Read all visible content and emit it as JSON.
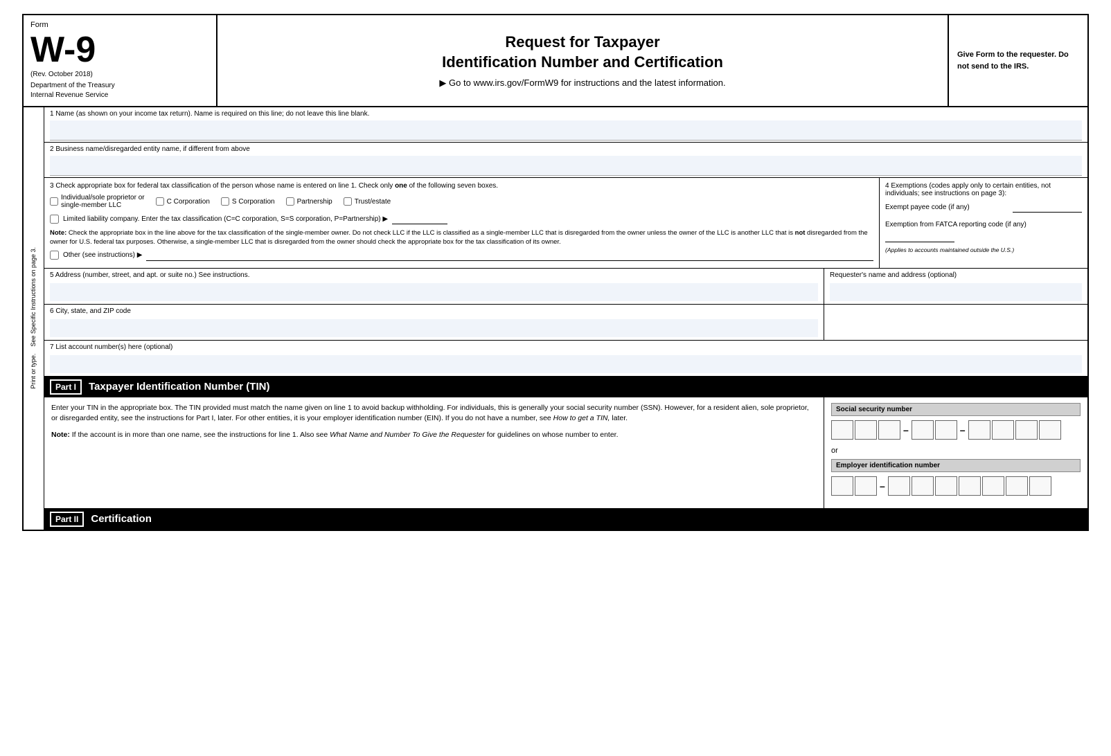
{
  "header": {
    "form_label": "Form",
    "w9": "W-9",
    "rev_date": "(Rev. October 2018)",
    "dept1": "Department of the Treasury",
    "dept2": "Internal Revenue Service",
    "main_title": "Request for Taxpayer\nIdentification Number and Certification",
    "go_to": "▶ Go to www.irs.gov/FormW9 for instructions and the latest information.",
    "right_text": "Give Form to the requester. Do not send to the IRS."
  },
  "fields": {
    "line1_label": "1  Name (as shown on your income tax return). Name is required on this line; do not leave this line blank.",
    "line2_label": "2  Business name/disregarded entity name, if different from above",
    "line3_label": "3  Check appropriate box for federal tax classification of the person whose name is entered on line 1. Check only one of the following seven boxes.",
    "cb_individual": "Individual/sole proprietor or single-member LLC",
    "cb_c_corp": "C Corporation",
    "cb_s_corp": "S Corporation",
    "cb_partnership": "Partnership",
    "cb_trust": "Trust/estate",
    "llc_label": "Limited liability company. Enter the tax classification (C=C corporation, S=S corporation, P=Partnership) ▶",
    "note_text": "Note: Check the appropriate box in the line above for the tax classification of the single-member owner. Do not check LLC if the LLC is classified as a single-member LLC that is disregarded from the owner unless the owner of the LLC is another LLC that is not disregarded from the owner for U.S. federal tax purposes. Otherwise, a single-member LLC that is disregarded from the owner should check the appropriate box for the tax classification of its owner.",
    "other_label": "Other (see instructions) ▶",
    "line4_title": "4  Exemptions (codes apply only to certain entities, not individuals; see instructions on page 3):",
    "exempt_payee_label": "Exempt payee code (if any)",
    "fatca_label": "Exemption from FATCA reporting code (if any)",
    "fatca_note": "(Applies to accounts maintained outside the U.S.)",
    "line5_label": "5  Address (number, street, and apt. or suite no.) See instructions.",
    "requester_label": "Requester's name and address (optional)",
    "line6_label": "6  City, state, and ZIP code",
    "line7_label": "7  List account number(s) here (optional)",
    "side_text": "Print or type.    See Specific Instructions on page 3."
  },
  "part1": {
    "badge": "Part I",
    "title": "Taxpayer Identification Number (TIN)",
    "description1": "Enter your TIN in the appropriate box. The TIN provided must match the name given on line 1 to avoid backup withholding. For individuals, this is generally your social security number (SSN). However, for a resident alien, sole proprietor, or disregarded entity, see the instructions for Part I, later. For other entities, it is your employer identification number (EIN). If you do not have a number, see",
    "description1b": "How to get a TIN,",
    "description1c": " later.",
    "note_label": "Note:",
    "note_text": " If the account is in more than one name, see the instructions for line 1. Also see ",
    "note_italic": "What Name and Number To Give the Requester",
    "note_end": " for guidelines on whose number to enter.",
    "ssn_label": "Social security number",
    "or_text": "or",
    "ein_label": "Employer identification number"
  },
  "part2": {
    "badge": "Part II",
    "title": "Certification"
  }
}
